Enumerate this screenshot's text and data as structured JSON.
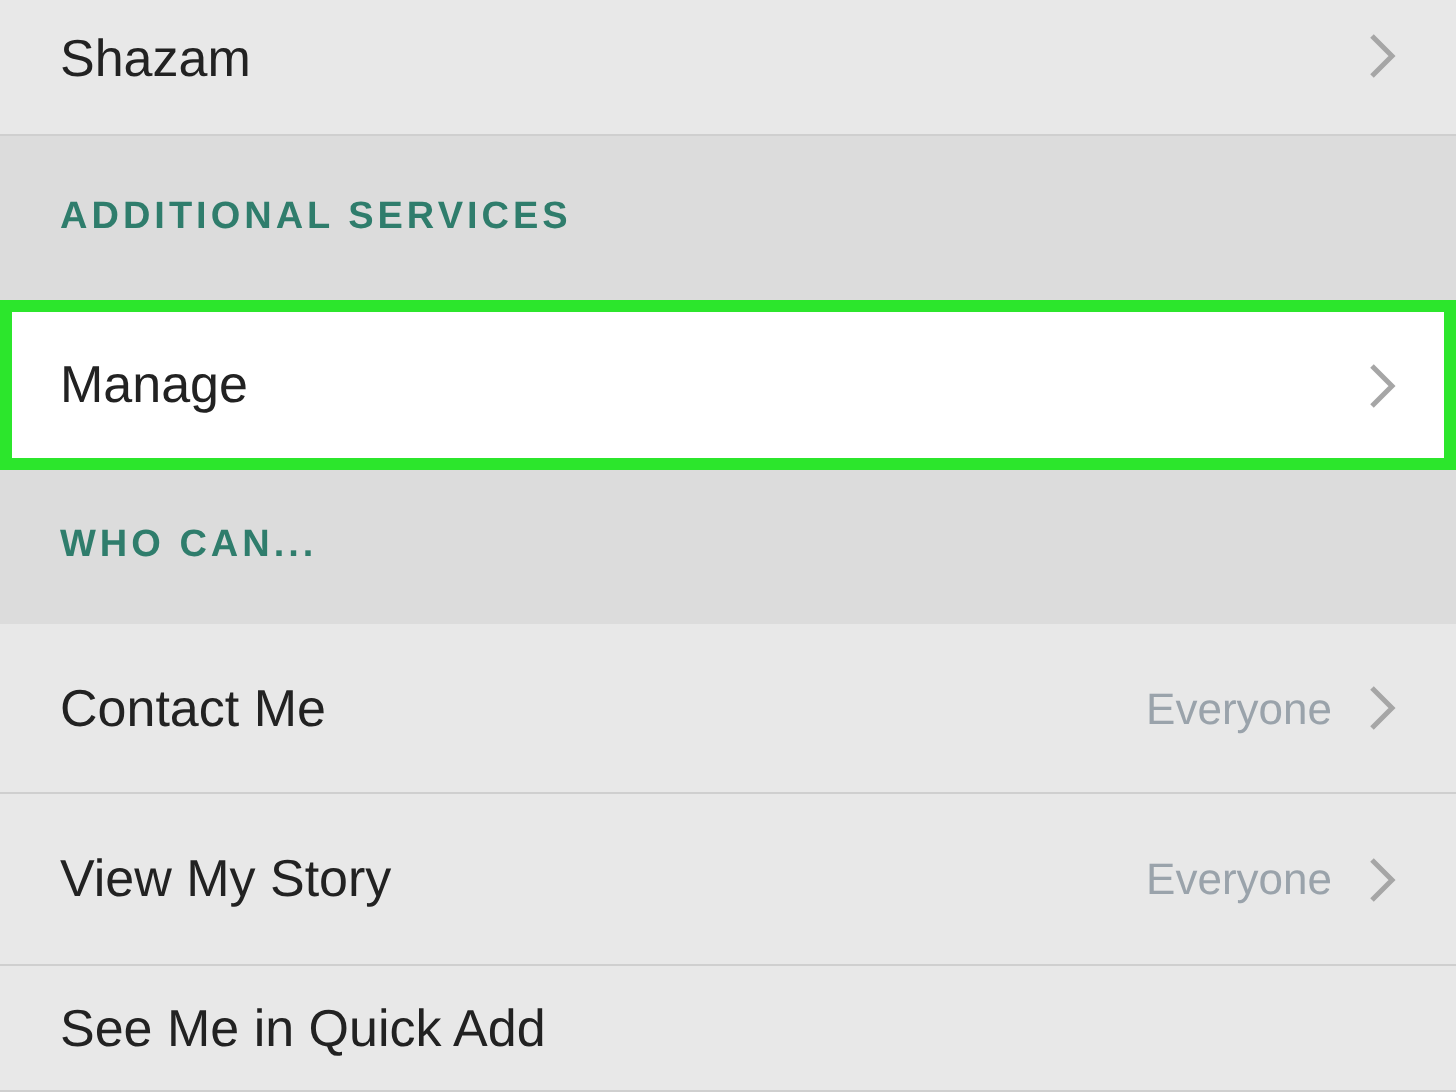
{
  "sections": [
    {
      "kind": "row",
      "label": "Shazam",
      "chevron": true,
      "highlighted": false
    },
    {
      "kind": "header",
      "label": "ADDITIONAL SERVICES"
    },
    {
      "kind": "row",
      "label": "Manage",
      "chevron": true,
      "highlighted": true
    },
    {
      "kind": "header",
      "label": "WHO CAN..."
    },
    {
      "kind": "row",
      "label": "Contact Me",
      "value": "Everyone",
      "chevron": true,
      "highlighted": false
    },
    {
      "kind": "row",
      "label": "View My Story",
      "value": "Everyone",
      "chevron": true,
      "highlighted": false
    },
    {
      "kind": "row",
      "label": "See Me in Quick Add",
      "chevron": false,
      "highlighted": false
    }
  ]
}
